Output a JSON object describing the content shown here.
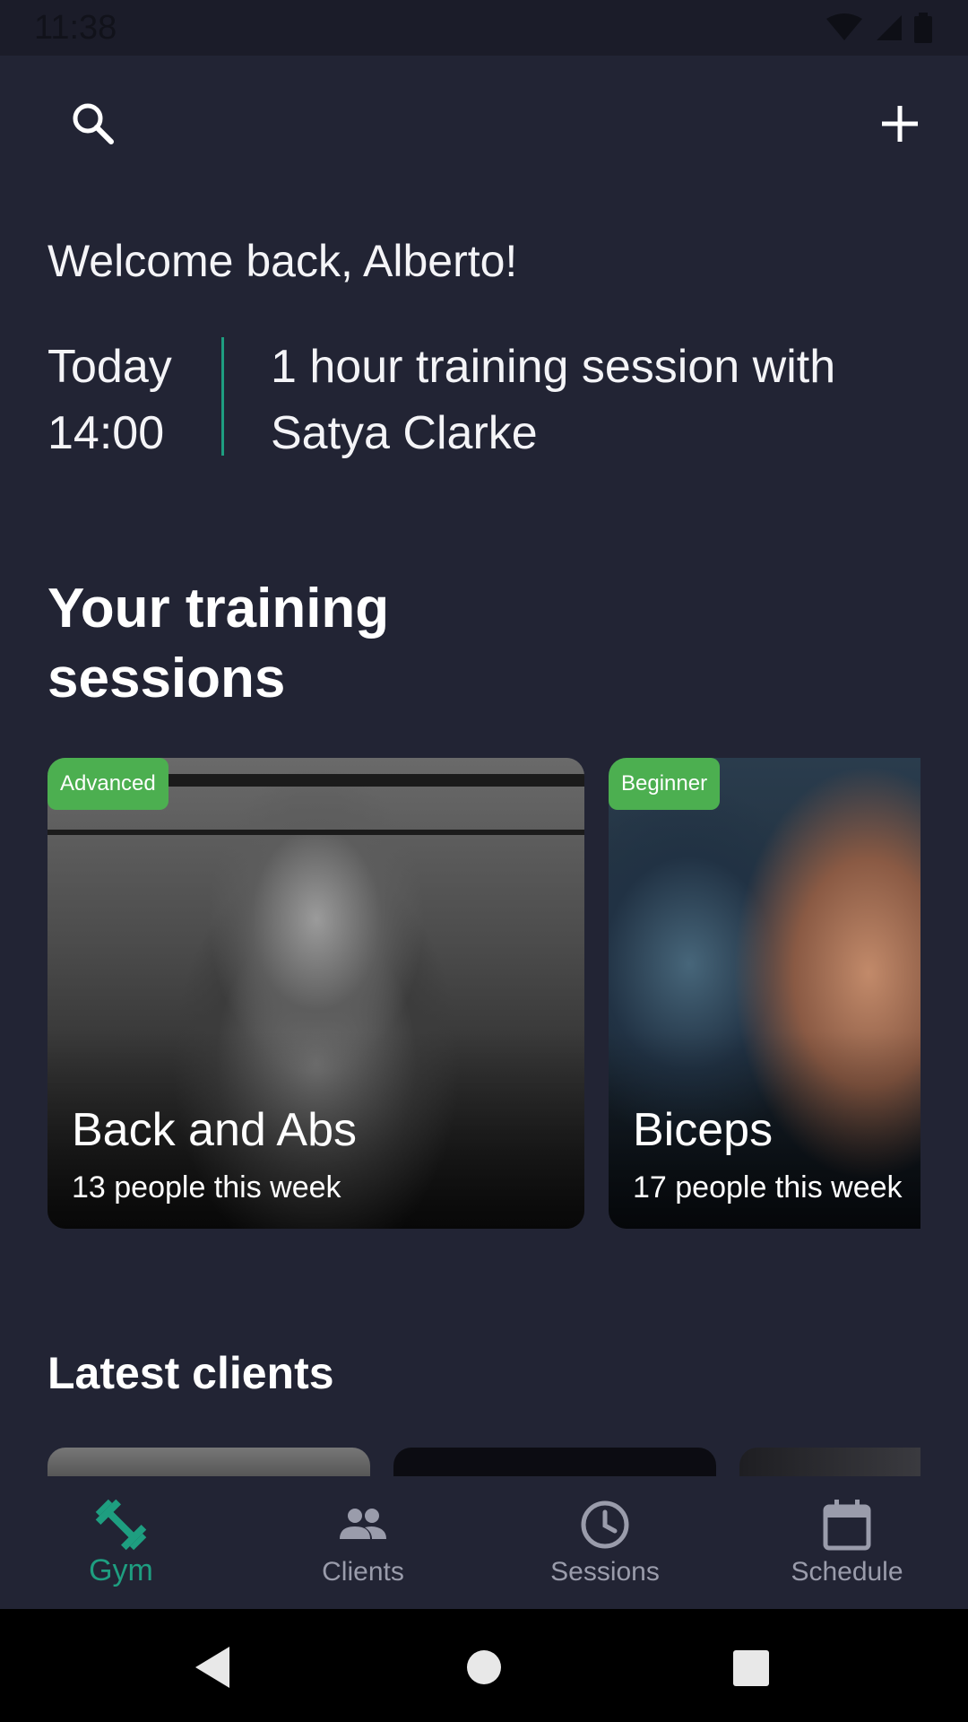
{
  "status_bar": {
    "time": "11:38"
  },
  "greeting": "Welcome back, Alberto!",
  "next_session": {
    "day": "Today",
    "time": "14:00",
    "description": "1 hour training session with Satya Clarke"
  },
  "training": {
    "title": "Your training sessions",
    "cards": [
      {
        "level": "Advanced",
        "name": "Back and Abs",
        "attendance": "13 people this week"
      },
      {
        "level": "Beginner",
        "name": "Biceps",
        "attendance": "17 people this week"
      }
    ]
  },
  "clients": {
    "title": "Latest clients"
  },
  "nav": {
    "items": [
      {
        "label": "Gym",
        "icon": "dumbbell-icon",
        "active": true
      },
      {
        "label": "Clients",
        "icon": "people-icon"
      },
      {
        "label": "Sessions",
        "icon": "clock-icon"
      },
      {
        "label": "Schedule",
        "icon": "calendar-icon"
      }
    ]
  },
  "colors": {
    "background": "#222434",
    "accent": "#1e9e80",
    "badge": "#4caf50"
  }
}
